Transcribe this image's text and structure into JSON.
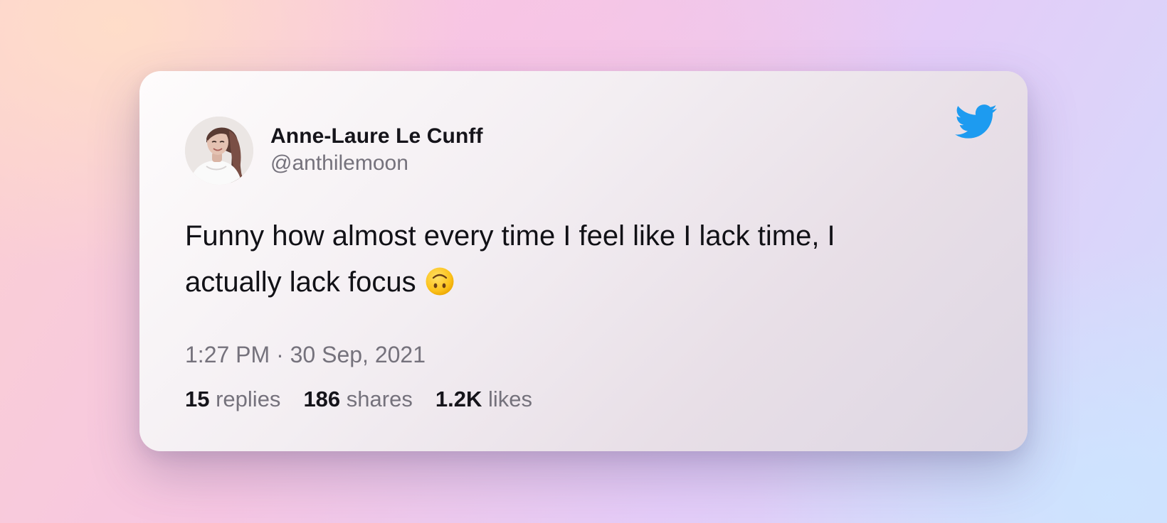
{
  "tweet": {
    "author_name": "Anne-Laure Le Cunff",
    "author_handle": "@anthilemoon",
    "text": "Funny how almost every time I feel like I lack time, I actually lack focus",
    "emoji": "upside-down-face-emoji",
    "timestamp": "1:27 PM · 30 Sep, 2021",
    "stats": {
      "replies_count": "15",
      "replies_label": "replies",
      "shares_count": "186",
      "shares_label": "shares",
      "likes_count": "1.2K",
      "likes_label": "likes"
    },
    "brand_icon": "twitter-bird-icon",
    "avatar_icon": "author-avatar"
  },
  "colors": {
    "twitter_blue": "#1D9BF0",
    "text_primary": "#15141a",
    "text_secondary": "#75727c"
  }
}
